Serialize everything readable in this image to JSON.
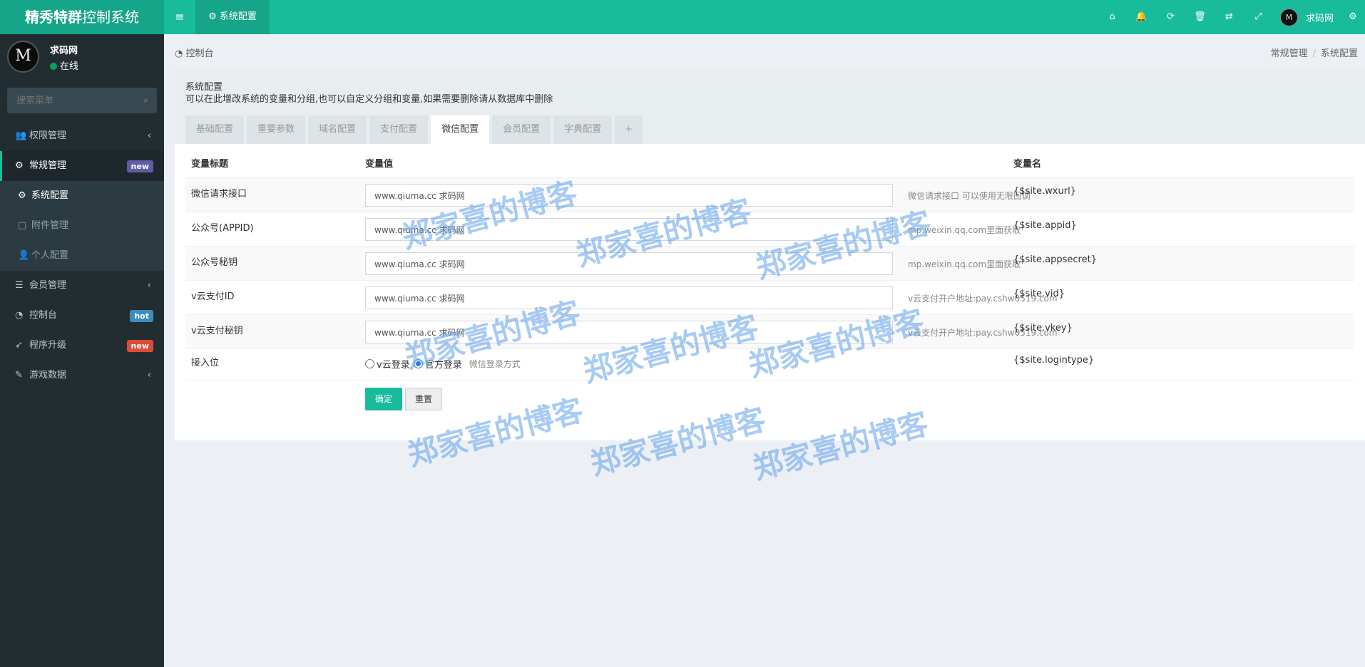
{
  "header": {
    "logo_bold": "精秀特群",
    "logo_rest": "控制系统",
    "toggle_glyph": "≡",
    "tab_label": "系统配置",
    "tab_icon": "⚙",
    "icons": [
      {
        "name": "home-icon",
        "glyph": "⌂"
      },
      {
        "name": "bell-icon",
        "glyph": "🔔"
      },
      {
        "name": "refresh-icon",
        "glyph": "⟳"
      },
      {
        "name": "trash-icon",
        "glyph": "🗑"
      },
      {
        "name": "translate-icon",
        "glyph": "⇄"
      },
      {
        "name": "fullscreen-icon",
        "glyph": "⤢"
      }
    ],
    "user_avatar": "M",
    "user_name": "求码网",
    "gear_glyph": "⚙"
  },
  "sidebar": {
    "user_avatar": "M",
    "user_name": "求码网",
    "user_status": "在线",
    "search_placeholder": "搜索菜单",
    "search_icon": "⌕",
    "items": [
      {
        "label": "权限管理",
        "icon": "👥",
        "arrow": "‹"
      },
      {
        "label": "常规管理",
        "icon": "⚙",
        "badge": "new",
        "badge_color": "#605ca8"
      },
      {
        "label": "会员管理",
        "icon": "☰",
        "arrow": "‹"
      },
      {
        "label": "控制台",
        "icon": "◔",
        "badge": "hot",
        "badge_color": "#3c8dbc"
      },
      {
        "label": "程序升级",
        "icon": "➶",
        "badge": "new",
        "badge_color": "#dd4b39"
      },
      {
        "label": "游戏数据",
        "icon": "✎",
        "arrow": "‹"
      }
    ],
    "sub_items": [
      {
        "label": "系统配置",
        "icon": "⚙"
      },
      {
        "label": "附件管理",
        "icon": "▢"
      },
      {
        "label": "个人配置",
        "icon": "👤"
      }
    ]
  },
  "breadcrumb": {
    "left_icon": "◔",
    "left": "控制台",
    "right_1": "常规管理",
    "sep": "/",
    "right_2": "系统配置"
  },
  "panel": {
    "title": "系统配置",
    "desc": "可以在此增改系统的变量和分组,也可以自定义分组和变量,如果需要删除请从数据库中删除",
    "tabs": [
      "基础配置",
      "重要参数",
      "域名配置",
      "支付配置",
      "微信配置",
      "会员配置",
      "字典配置"
    ],
    "tab_plus": "+",
    "headers": {
      "title": "变量标题",
      "value": "变量值",
      "name": "变量名"
    },
    "rows": [
      {
        "title": "微信请求接口",
        "value": "www.qiuma.cc 求码网",
        "help": "微信请求接口 可以使用无限回调",
        "name": "{$site.wxurl}"
      },
      {
        "title": "公众号(APPID)",
        "value": "www.qiuma.cc 求码网",
        "help": "mp.weixin.qq.com里面获取",
        "name": "{$site.appid}"
      },
      {
        "title": "公众号秘钥",
        "value": "www.qiuma.cc 求码网",
        "help": "mp.weixin.qq.com里面获取",
        "name": "{$site.appsecret}"
      },
      {
        "title": "v云支付ID",
        "value": "www.qiuma.cc 求码网",
        "help": "v云支付开户地址:pay.cshw0519.com",
        "name": "{$site.vid}"
      },
      {
        "title": "v云支付秘钥",
        "value": "www.qiuma.cc 求码网",
        "help": "v云支付开户地址:pay.cshw0519.com",
        "name": "{$site.vkey}"
      }
    ],
    "login_row": {
      "title": "接入位",
      "option_1": "v云登录",
      "option_2": "官方登录",
      "selected": "官方登录",
      "hint": "微信登录方式",
      "name": "{$site.logintype}"
    },
    "ok_button": "确定",
    "reset_button": "重置"
  },
  "watermark": "郑家喜的博客",
  "colors": {
    "primary": "#18bc9c",
    "sidebar_bg": "#222d32",
    "content_bg": "#ecf0f5"
  }
}
